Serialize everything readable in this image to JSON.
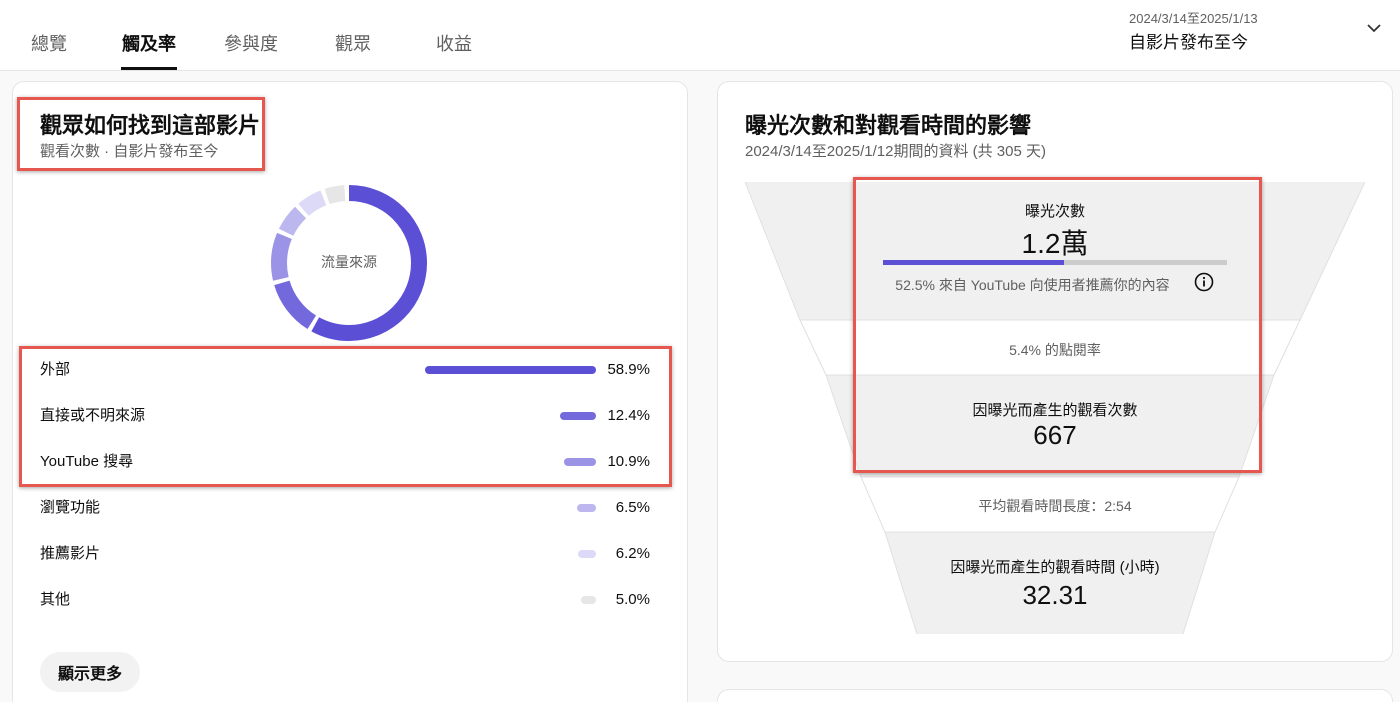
{
  "tabs": [
    {
      "label": "總覽",
      "active": false
    },
    {
      "label": "觸及率",
      "active": true
    },
    {
      "label": "參與度",
      "active": false
    },
    {
      "label": "觀眾",
      "active": false
    },
    {
      "label": "收益",
      "active": false
    }
  ],
  "date_selector": {
    "range": "2024/3/14至2025/1/13",
    "label": "自影片發布至今",
    "icon": "chevron-down-icon"
  },
  "traffic_card": {
    "title": "觀眾如何找到這部影片",
    "subtitle": "觀看次數 · 自影片發布至今",
    "donut_center": "流量來源",
    "sources": [
      {
        "label": "外部",
        "pct": "58.9%",
        "value": 58.9,
        "color": "#5b4fd6"
      },
      {
        "label": "直接或不明來源",
        "pct": "12.4%",
        "value": 12.4,
        "color": "#7468dd"
      },
      {
        "label": "YouTube 搜尋",
        "pct": "10.9%",
        "value": 10.9,
        "color": "#9b93e6"
      },
      {
        "label": "瀏覽功能",
        "pct": "6.5%",
        "value": 6.5,
        "color": "#bcb7ee"
      },
      {
        "label": "推薦影片",
        "pct": "6.2%",
        "value": 6.2,
        "color": "#dcdaf6"
      },
      {
        "label": "其他",
        "pct": "5.0%",
        "value": 5.0,
        "color": "#e6e6e6"
      }
    ],
    "show_more": "顯示更多"
  },
  "funnel_card": {
    "title": "曝光次數和對觀看時間的影響",
    "subtitle": "2024/3/14至2025/1/12期間的資料 (共 305 天)",
    "impressions_label": "曝光次數",
    "impressions_value": "1.2萬",
    "impressions_bar_fraction": 0.525,
    "impressions_note": "52.5% 來自 YouTube 向使用者推薦你的內容",
    "info_icon": "info-icon",
    "ctr": "5.4% 的點閱率",
    "views_label": "因曝光而產生的觀看次數",
    "views_value": "667",
    "avg_duration": "平均觀看時間長度：2:54",
    "watch_time_label": "因曝光而產生的觀看時間 (小時)",
    "watch_time_value": "32.31"
  },
  "colors": {
    "accent": "#5b4fd6",
    "highlight": "#e5574f"
  }
}
